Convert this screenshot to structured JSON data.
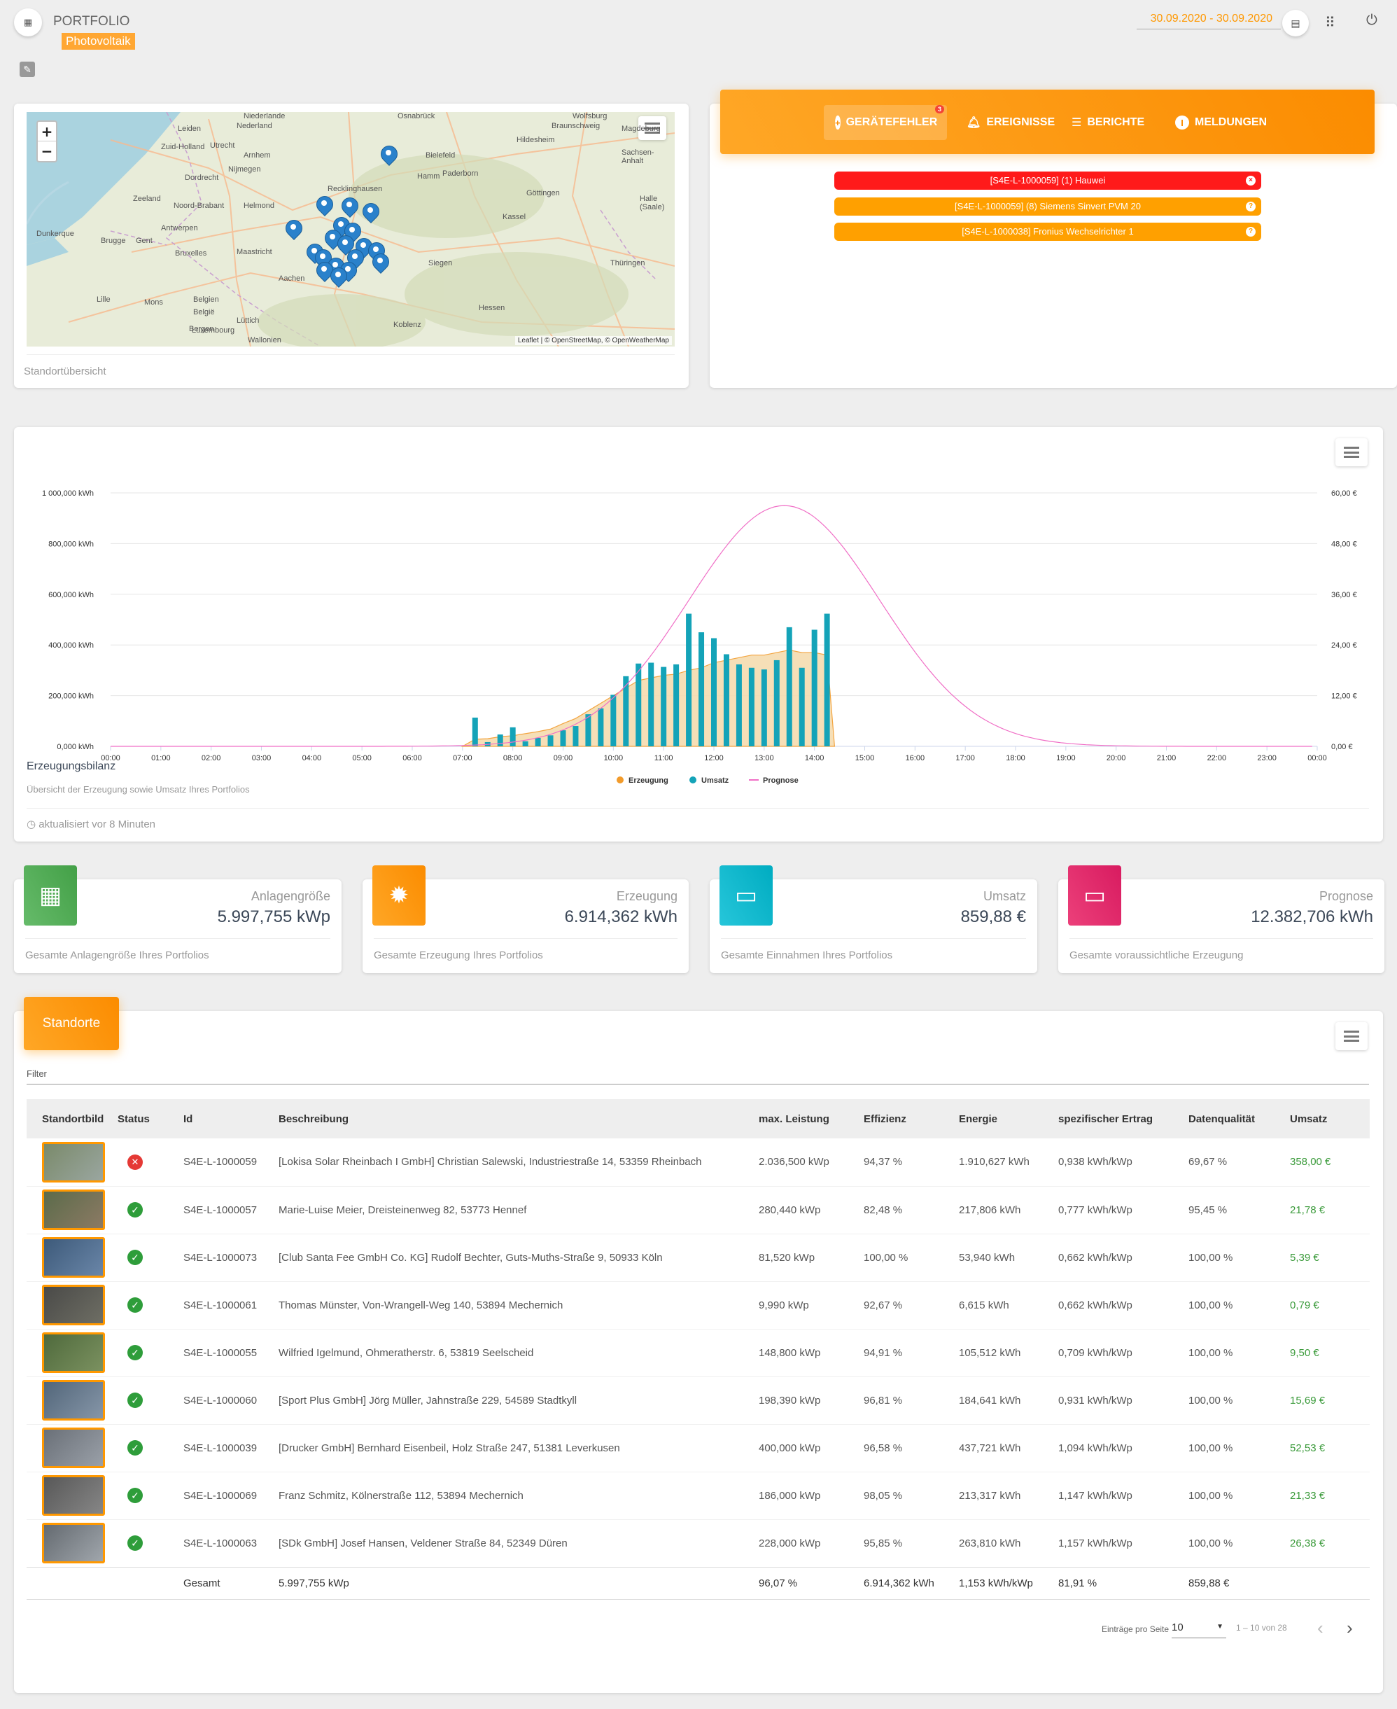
{
  "header": {
    "title": "PORTFOLIO",
    "subtitle": "Photovoltaik",
    "date_range": "30.09.2020 - 30.09.2020"
  },
  "map_card": {
    "footer": "Standortübersicht",
    "attribution": "Leaflet | © OpenStreetMap, © OpenWeatherMap",
    "zoom_in": "+",
    "zoom_out": "−",
    "labels": [
      "Niederlande",
      "Nederland",
      "Osnabrück",
      "Wolfsburg",
      "Braunschweig",
      "Magdeburg",
      "Hildesheim",
      "Sachsen-Anhalt",
      "Leiden",
      "Utrecht",
      "Bielefeld",
      "Paderborn",
      "Hamm",
      "Zuid-Holland",
      "Arnhem",
      "Dordrecht",
      "Nijmegen",
      "Göttingen",
      "Recklinghausen",
      "Halle (Saale)",
      "Kassel",
      "Zeeland",
      "Noord-Brabant",
      "Helmond",
      "Antwerpen",
      "Dunkerque",
      "Brugge",
      "Gent",
      "Bruxelles",
      "Maastricht",
      "Siegen",
      "Thüringen",
      "Lille",
      "Mons",
      "Belgien",
      "België",
      "Luxembourg",
      "Hessen",
      "Koblenz",
      "Wallonien",
      "Lüttich",
      "Aachen",
      "Bergen"
    ]
  },
  "alerts": {
    "tabs": [
      {
        "label": "GERÄTEFEHLER",
        "badge": "3",
        "icon": "plus-circle-icon"
      },
      {
        "label": "EREIGNISSE",
        "icon": "bell-icon"
      },
      {
        "label": "BERICHTE",
        "icon": "list-icon"
      },
      {
        "label": "MELDUNGEN",
        "icon": "info-icon"
      }
    ],
    "messages": [
      {
        "text": "[S4E-L-1000059] (1) Hauwei",
        "color": "#ff1a1a",
        "icon": "close-icon"
      },
      {
        "text": "[S4E-L-1000059] (8) Siemens Sinvert PVM 20",
        "color": "#ffa000",
        "icon": "help-icon"
      },
      {
        "text": "[S4E-L-1000038] Fronius Wechselrichter 1",
        "color": "#ffa000",
        "icon": "help-icon"
      }
    ]
  },
  "chart_card": {
    "title": "Erzeugungsbilanz",
    "subtitle": "Übersicht der Erzeugung sowie Umsatz Ihres Portfolios",
    "updated": "aktualisiert vor 8 Minuten"
  },
  "chart_data": {
    "type": "bar",
    "x_ticks": [
      "00:00",
      "01:00",
      "02:00",
      "03:00",
      "04:00",
      "05:00",
      "06:00",
      "07:00",
      "08:00",
      "09:00",
      "10:00",
      "11:00",
      "12:00",
      "13:00",
      "14:00",
      "15:00",
      "16:00",
      "17:00",
      "18:00",
      "19:00",
      "20:00",
      "21:00",
      "22:00",
      "23:00",
      "00:00"
    ],
    "y_left_ticks": [
      "0,000 kWh",
      "200,000 kWh",
      "400,000 kWh",
      "600,000 kWh",
      "800,000 kWh",
      "1 000,000 kWh"
    ],
    "y_right_ticks": [
      "0,00 €",
      "12,00 €",
      "24,00 €",
      "36,00 €",
      "48,00 €",
      "60,00 €"
    ],
    "ylim_left": [
      0,
      1000000
    ],
    "ylim_right": [
      0,
      60
    ],
    "legend": [
      "Erzeugung",
      "Umsatz",
      "Prognose"
    ],
    "colors": {
      "erzeugung": "#f29b2b",
      "umsatz": "#14a3b8",
      "prognose": "#f06ec6"
    },
    "bar_hours": [
      7.25,
      7.5,
      7.75,
      8.0,
      8.25,
      8.5,
      8.75,
      9.0,
      9.25,
      9.5,
      9.75,
      10.0,
      10.25,
      10.5,
      10.75,
      11.0,
      11.25,
      11.5,
      11.75,
      12.0,
      12.25,
      12.5,
      12.75,
      13.0,
      13.25,
      13.5,
      13.75,
      14.0,
      14.25
    ],
    "umsatz_eur": [
      6.8,
      1.0,
      2.8,
      4.5,
      1.2,
      2.0,
      2.6,
      3.8,
      4.8,
      7.6,
      9.0,
      12.2,
      16.6,
      19.6,
      19.8,
      18.8,
      19.4,
      31.4,
      27.0,
      25.6,
      21.8,
      19.4,
      18.6,
      18.2,
      20.4,
      28.2,
      18.6,
      27.6,
      31.4
    ],
    "erzeugung_kwh": [
      28000,
      30000,
      38000,
      42000,
      50000,
      58000,
      68000,
      90000,
      110000,
      140000,
      170000,
      200000,
      230000,
      260000,
      270000,
      280000,
      285000,
      300000,
      310000,
      330000,
      340000,
      350000,
      360000,
      360000,
      370000,
      380000,
      370000,
      370000,
      360000
    ],
    "prognose_peak_hour": 13.4,
    "prognose_peak_kwh": 950000
  },
  "stats": [
    {
      "title": "Anlagengröße",
      "value": "5.997,755 kWp",
      "footer": "Gesamte Anlagengröße Ihres Portfolios",
      "color": "#4caf50",
      "icon": "solar-panel-icon"
    },
    {
      "title": "Erzeugung",
      "value": "6.914,362 kWh",
      "footer": "Gesamte Erzeugung Ihres Portfolios",
      "color": "#ff9800",
      "icon": "sun-icon"
    },
    {
      "title": "Umsatz",
      "value": "859,88 €",
      "footer": "Gesamte Einnahmen Ihres Portfolios",
      "color": "#00bcd4",
      "icon": "wallet-icon"
    },
    {
      "title": "Prognose",
      "value": "12.382,706 kWh",
      "footer": "Gesamte voraussichtliche Erzeugung",
      "color": "#e91e63",
      "icon": "laptop-icon"
    }
  ],
  "sites": {
    "header_label": "Standorte",
    "filter_label": "Filter",
    "columns": [
      "Standortbild",
      "Status",
      "Id",
      "Beschreibung",
      "max. Leistung",
      "Effizienz",
      "Energie",
      "spezifischer Ertrag",
      "Datenqualität",
      "Umsatz"
    ],
    "rows": [
      {
        "status": "error",
        "id": "S4E-L-1000059",
        "desc": "[Lokisa Solar Rheinbach I GmbH] Christian Salewski, Industriestraße 14, 53359 Rheinbach",
        "power": "2.036,500 kWp",
        "eff": "94,37 %",
        "energy": "1.910,627 kWh",
        "yield": "0,938 kWh/kWp",
        "quality": "69,67 %",
        "revenue": "358,00 €"
      },
      {
        "status": "ok",
        "id": "S4E-L-1000057",
        "desc": "Marie-Luise Meier, Dreisteinenweg 82, 53773 Hennef",
        "power": "280,440 kWp",
        "eff": "82,48 %",
        "energy": "217,806 kWh",
        "yield": "0,777 kWh/kWp",
        "quality": "95,45 %",
        "revenue": "21,78 €"
      },
      {
        "status": "ok",
        "id": "S4E-L-1000073",
        "desc": "[Club Santa Fee GmbH Co. KG] Rudolf Bechter, Guts-Muths-Straße 9, 50933 Köln",
        "power": "81,520 kWp",
        "eff": "100,00 %",
        "energy": "53,940 kWh",
        "yield": "0,662 kWh/kWp",
        "quality": "100,00 %",
        "revenue": "5,39 €"
      },
      {
        "status": "ok",
        "id": "S4E-L-1000061",
        "desc": "Thomas Münster, Von-Wrangell-Weg 140, 53894 Mechernich",
        "power": "9,990 kWp",
        "eff": "92,67 %",
        "energy": "6,615 kWh",
        "yield": "0,662 kWh/kWp",
        "quality": "100,00 %",
        "revenue": "0,79 €"
      },
      {
        "status": "ok",
        "id": "S4E-L-1000055",
        "desc": "Wilfried Igelmund, Ohmeratherstr. 6, 53819 Seelscheid",
        "power": "148,800 kWp",
        "eff": "94,91 %",
        "energy": "105,512 kWh",
        "yield": "0,709 kWh/kWp",
        "quality": "100,00 %",
        "revenue": "9,50 €"
      },
      {
        "status": "ok",
        "id": "S4E-L-1000060",
        "desc": "[Sport Plus GmbH] Jörg Müller, Jahnstraße 229, 54589 Stadtkyll",
        "power": "198,390 kWp",
        "eff": "96,81 %",
        "energy": "184,641 kWh",
        "yield": "0,931 kWh/kWp",
        "quality": "100,00 %",
        "revenue": "15,69 €"
      },
      {
        "status": "ok",
        "id": "S4E-L-1000039",
        "desc": "[Drucker GmbH] Bernhard Eisenbeil, Holz Straße 247, 51381 Leverkusen",
        "power": "400,000 kWp",
        "eff": "96,58 %",
        "energy": "437,721 kWh",
        "yield": "1,094 kWh/kWp",
        "quality": "100,00 %",
        "revenue": "52,53 €"
      },
      {
        "status": "ok",
        "id": "S4E-L-1000069",
        "desc": "Franz Schmitz, Kölnerstraße 112, 53894 Mechernich",
        "power": "186,000 kWp",
        "eff": "98,05 %",
        "energy": "213,317 kWh",
        "yield": "1,147 kWh/kWp",
        "quality": "100,00 %",
        "revenue": "21,33 €"
      },
      {
        "status": "ok",
        "id": "S4E-L-1000063",
        "desc": "[SDk GmbH] Josef Hansen, Veldener Straße 84, 52349 Düren",
        "power": "228,000 kWp",
        "eff": "95,85 %",
        "energy": "263,810 kWh",
        "yield": "1,157 kWh/kWp",
        "quality": "100,00 %",
        "revenue": "26,38 €"
      }
    ],
    "totals": {
      "label": "Gesamt",
      "power": "5.997,755 kWp",
      "eff": "96,07 %",
      "energy": "6.914,362 kWh",
      "yield": "1,153 kWh/kWp",
      "quality": "81,91 %",
      "revenue": "859,88 €"
    },
    "pagination": {
      "per_page_label": "Einträge pro Seite",
      "per_page": "10",
      "range": "1 – 10 von 28",
      "prev": "‹",
      "next": "›"
    }
  }
}
